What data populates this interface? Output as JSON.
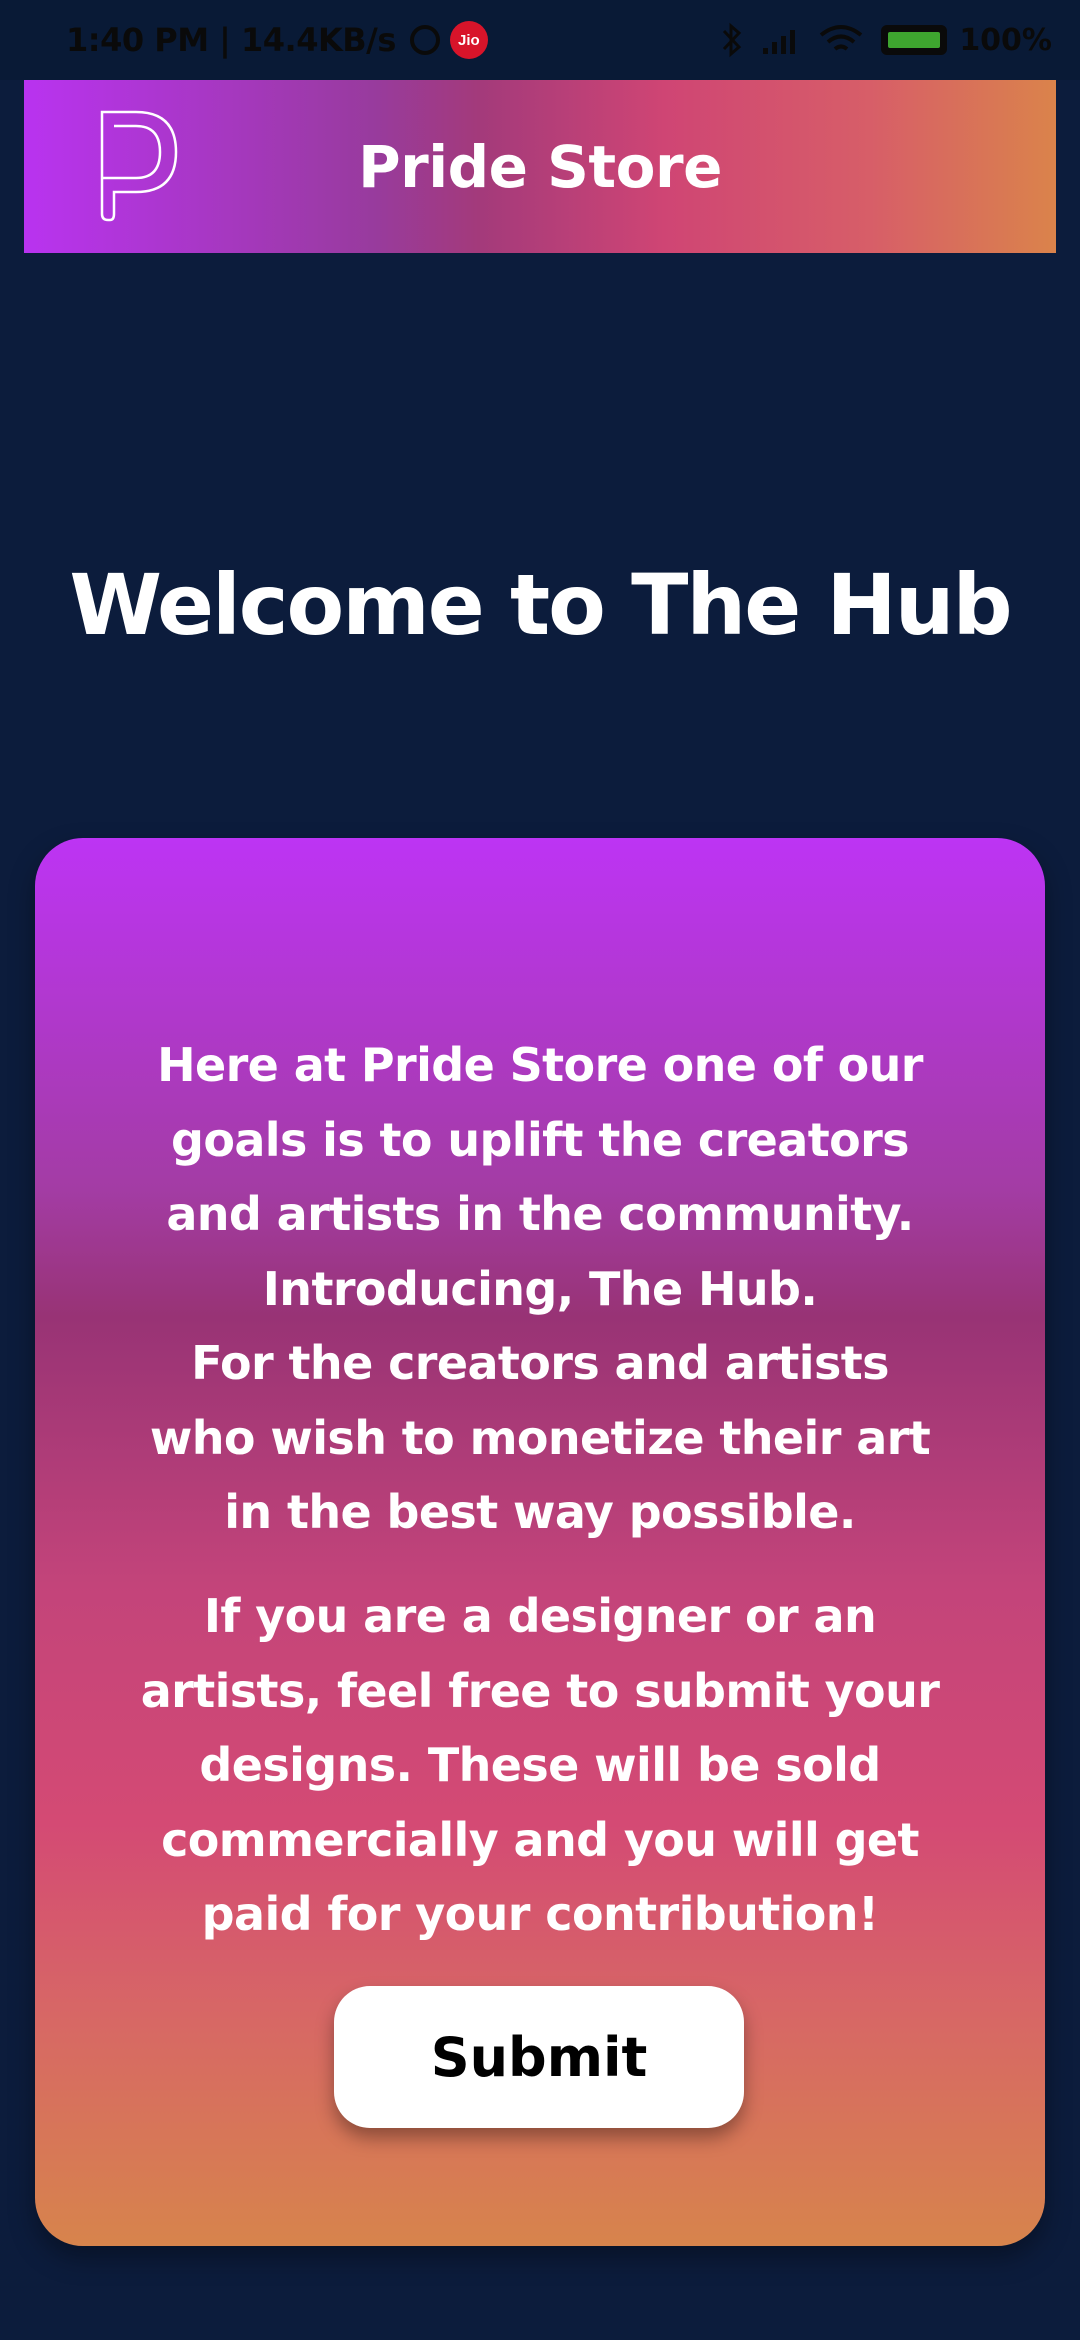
{
  "status_bar": {
    "time_speed": "1:40 PM | 14.4KB/s",
    "carrier_badge": "Jio",
    "battery_percent": "100%",
    "icons": [
      "alarm-icon",
      "jio-icon",
      "bluetooth-icon",
      "signal-icon",
      "wifi-icon",
      "battery-icon"
    ]
  },
  "app_bar": {
    "title": "Pride Store",
    "logo_icon": "pride-store-logo-icon",
    "gradient": [
      "#b933f0",
      "#983b9d",
      "#cf4574",
      "#da834b"
    ]
  },
  "hero": {
    "title": "Welcome to The Hub"
  },
  "card": {
    "intro": "Here at Pride Store one of our\ngoals is to uplift the creators\nand artists in the community.\nIntroducing, The Hub.\nFor the creators and artists\nwho wish to monetize their art\nin the best way possible.",
    "invite": "If you are a designer or an\nartists, feel free to submit your\ndesigns. These will be sold\ncommercially and you will get\npaid for your contribution!",
    "submit_label": "Submit",
    "gradient": [
      "#bd34f4",
      "#983375",
      "#d44a74",
      "#d7844c"
    ]
  },
  "colors": {
    "background": "#0c1c3c",
    "text": "#ffffff",
    "button_bg": "#ffffff",
    "button_text": "#000000"
  }
}
